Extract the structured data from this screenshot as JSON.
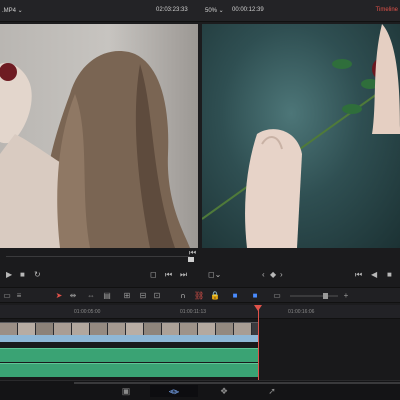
{
  "header": {
    "filename": ".MP4 ⌄",
    "source_timecode": "02:03:23:33",
    "zoom": "50% ⌄",
    "timeline_timecode": "00:00:12:39",
    "timeline_label": "Timeline"
  },
  "ruler": {
    "ticks": [
      "01:00:05:00",
      "01:00:11:13",
      "01:00:16:06"
    ]
  },
  "colors": {
    "accent": "#e0524a",
    "clip_bar": "#8fb7d6",
    "audio_track": "#3aa374",
    "active_page": "#7fb0ff"
  },
  "icons": {
    "page_nav": [
      "media-icon",
      "edit-icon",
      "fusion-icon",
      "deliver-icon"
    ]
  }
}
